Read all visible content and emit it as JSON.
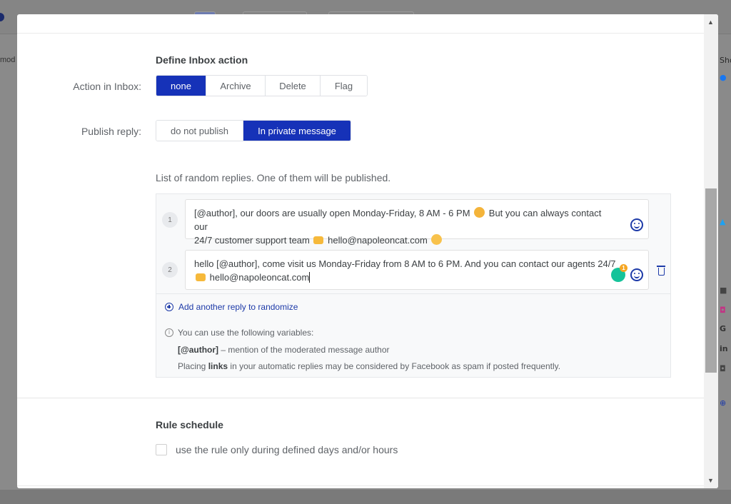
{
  "background": {
    "left_text": "mod",
    "right_text": "Sho",
    "right_bottom_text": "A"
  },
  "inbox_action": {
    "section_title": "Define Inbox action",
    "label": "Action in Inbox:",
    "options": [
      "none",
      "Archive",
      "Delete",
      "Flag"
    ],
    "selected": "none"
  },
  "publish_reply": {
    "label": "Publish reply:",
    "options": [
      "do not publish",
      "In private message"
    ],
    "selected": "In private message"
  },
  "replies": {
    "intro": "List of random replies. One of them will be published.",
    "items": [
      {
        "number": "1",
        "line1_a": "[@author], our doors are usually open Monday-Friday, 8 AM - 6 PM",
        "line1_b": "But you can always contact our",
        "line2_a": "24/7 customer support team",
        "line2_b": "hello@napoleoncat.com"
      },
      {
        "number": "2",
        "line1": "hello [@author], come visit us Monday-Friday from 8 AM to 6 PM. And you can contact our agents 24/7",
        "line2": "hello@napoleoncat.com",
        "grammarly_count": "1"
      }
    ],
    "add_label": "Add another reply to randomize",
    "info_text": "You can use the following variables:",
    "variable_name": "[@author]",
    "variable_desc": " – mention of the moderated message author",
    "links_pre": "Placing ",
    "links_bold": "links",
    "links_post": " in your automatic replies may be considered by Facebook as spam if posted frequently."
  },
  "schedule": {
    "section_title": "Rule schedule",
    "checkbox_label": "use the rule only during defined days and/or hours",
    "checked": false
  },
  "colors": {
    "accent": "#1632b8",
    "link": "#1d3aa8",
    "grammarly": "#15c39a"
  }
}
